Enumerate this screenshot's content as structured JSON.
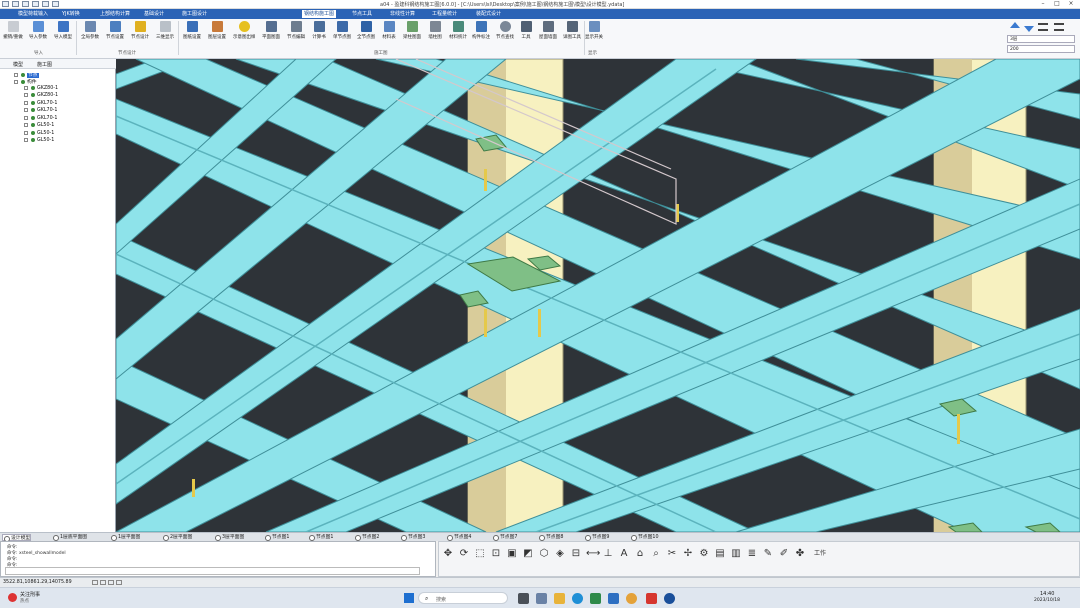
{
  "window": {
    "title": "a04 - 盈建科钢结构施工图[6.0.0] - [C:\\Users\\lsl\\Desktop\\案例\\施工图\\钢结构施工图\\模型\\设计模型.ydata]"
  },
  "menu_tabs": [
    "模型荷载输入",
    "上部结构计算",
    "基础设计",
    "施工图设计",
    "钢结构施工图",
    "节点工具",
    "非线性计算",
    "工程量统计",
    "装配式设计"
  ],
  "menu_tabs_short": [
    "模型荷载输入",
    "YJK转换",
    "上部结构计算",
    "基础设计",
    "施工图设计",
    "钢结构施工图",
    "节点工具",
    "非线性计算",
    "工程量统计",
    "装配式设计"
  ],
  "active_menu_tab": "钢结构施工图",
  "ribbon": {
    "buttons": [
      "撤销/重做",
      "导入参数",
      "导入模型",
      "全局参数",
      "节点设置",
      "节点设计",
      "三维显示",
      "图纸设置",
      "图层设置",
      "示意图出样",
      "平面图面",
      "节点编辑",
      "计算书",
      "单节点图",
      "全节点图",
      "材料表",
      "梁柱图面",
      "墙柱图",
      "材料统计",
      "构件标注",
      "节点查找",
      "工具",
      "屋面墙面",
      "详图工具",
      "显示开关"
    ],
    "groups": [
      "导入",
      "节点设计",
      "施工图",
      "显示"
    ],
    "selects": [
      "3层",
      "200"
    ]
  },
  "left_panel": {
    "tabs": [
      "模型",
      "施工图"
    ],
    "tree_root1": "节点",
    "tree_root2": "构件",
    "tree_items": [
      "GKZ80-1",
      "GKZ80-1",
      "GKL70-1",
      "GKL70-1",
      "GKL70-1",
      "GL50-1",
      "GL50-1",
      "GL50-1"
    ]
  },
  "view_tabs": [
    "设计模型",
    "1层底平面图",
    "1层平面图",
    "2层平面图",
    "3层平面图",
    "节点图1",
    "节点图1",
    "节点图1",
    "节点图4",
    "节点图7",
    "节点图8",
    "节点图9",
    "节点图10"
  ],
  "view_tabs_labels": [
    "设计模型",
    "1层底平面图",
    "1层平面图",
    "2层平面图",
    "3层平面图",
    "节点图1",
    "节点图2",
    "节点图3",
    "节点图4",
    "节点图7",
    "节点图8",
    "节点图9",
    "节点图10"
  ],
  "command": {
    "lines": [
      "命令:",
      "命令: xsteel_showallmodel",
      "命令:",
      "命令:"
    ],
    "input_placeholder": ""
  },
  "toolbar_icons": [
    "pan-icon",
    "rotate-icon",
    "zoom-window-icon",
    "zoom-all-icon",
    "view-cube-icon",
    "shade-icon",
    "wireframe-icon",
    "iso-icon",
    "section-icon",
    "measure-icon",
    "dimension-icon",
    "text-icon",
    "tag-icon",
    "search-icon",
    "clip-icon",
    "move-icon",
    "settings-icon",
    "pdf-icon",
    "dwg-icon",
    "layer-icon",
    "tool-icon",
    "brush-icon",
    "plot-icon",
    "work-icon"
  ],
  "toolbar_label_last": "工作",
  "status": {
    "coords": "3522.81,10861.29,14075.89"
  },
  "taskbar": {
    "left_title": "关注刑事",
    "left_sub": "热点",
    "search_placeholder": "搜索",
    "time": "14:40",
    "date": "2023/10/18"
  },
  "colors": {
    "menubar": "#2b63b6",
    "beam": "#8ee3ea",
    "column": "#f6f0bf",
    "plate": "#7fbf86",
    "background": "#2e3338"
  }
}
